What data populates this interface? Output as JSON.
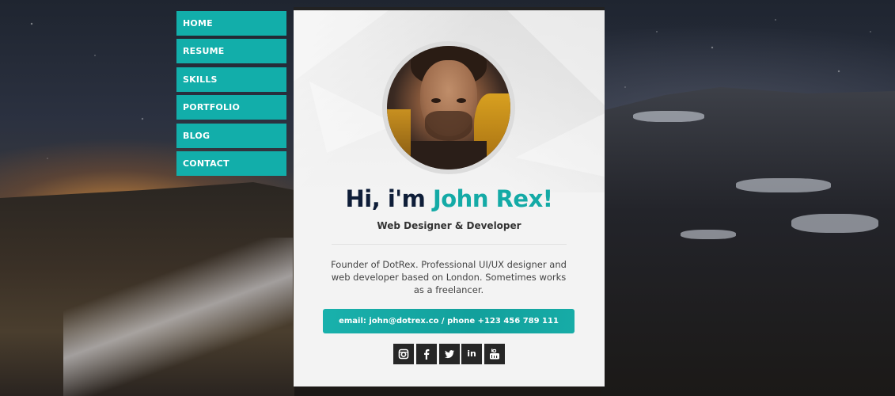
{
  "nav": {
    "items": [
      {
        "label": "HOME"
      },
      {
        "label": "RESUME"
      },
      {
        "label": "SKILLS"
      },
      {
        "label": "PORTFOLIO"
      },
      {
        "label": "BLOG"
      },
      {
        "label": "CONTACT"
      }
    ]
  },
  "profile": {
    "greeting": "Hi, i'm ",
    "name": "John Rex!",
    "title": "Web Designer & Developer",
    "bio": "Founder of DotRex. Professional UI/UX designer and web developer based on London. Sometimes works as a freelancer.",
    "contact_label": "email: john@dotrex.co / phone +123 456 789 111"
  },
  "socials": [
    {
      "icon": "instagram-icon"
    },
    {
      "icon": "facebook-icon"
    },
    {
      "icon": "twitter-icon"
    },
    {
      "icon": "linkedin-icon",
      "label": "in"
    },
    {
      "icon": "youtube-icon"
    }
  ],
  "colors": {
    "accent": "#12aeaa",
    "heading": "#0e1d38",
    "social_bg": "#262626",
    "card_bg": "#f3f3f3"
  }
}
